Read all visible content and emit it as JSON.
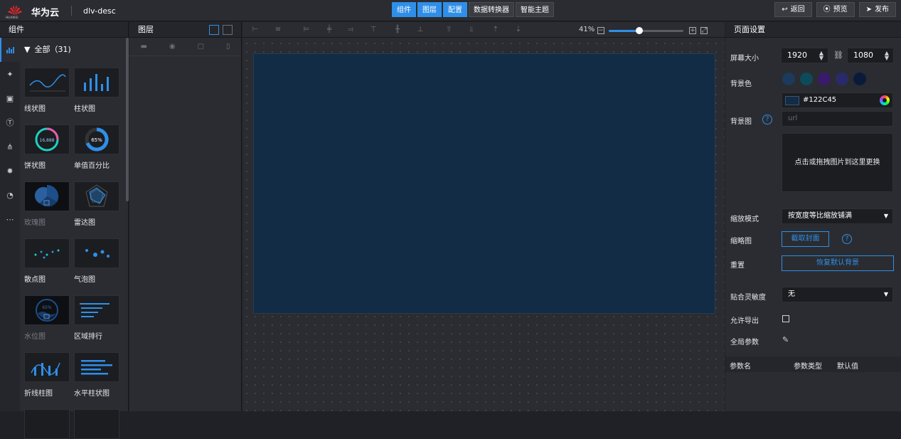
{
  "header": {
    "logo_text": "HUAWEI",
    "brand": "华为云",
    "project": "dlv-desc",
    "tabs": [
      {
        "label": "组件",
        "active": true
      },
      {
        "label": "图层",
        "active": true
      },
      {
        "label": "配置",
        "active": true
      },
      {
        "label": "数据转换器",
        "active": false
      },
      {
        "label": "智能主题",
        "active": false
      }
    ],
    "actions": {
      "back": "返回",
      "preview": "预览",
      "publish": "发布"
    }
  },
  "components": {
    "title": "组件",
    "category_label": "全部（31)",
    "items": [
      {
        "label": "线状图",
        "disabled": false
      },
      {
        "label": "柱状图",
        "disabled": false
      },
      {
        "label": "饼状图",
        "disabled": false
      },
      {
        "label": "单值百分比",
        "disabled": false
      },
      {
        "label": "玫瑰图",
        "disabled": true
      },
      {
        "label": "雷达图",
        "disabled": false
      },
      {
        "label": "散点图",
        "disabled": false
      },
      {
        "label": "气泡图",
        "disabled": false
      },
      {
        "label": "水位图",
        "disabled": true
      },
      {
        "label": "区域排行",
        "disabled": false
      },
      {
        "label": "折线柱图",
        "disabled": false
      },
      {
        "label": "水平柱状图",
        "disabled": false
      }
    ],
    "thumb_texts": {
      "pie": "16,888",
      "percent": "65%",
      "water": "65%"
    }
  },
  "layers": {
    "title": "图层"
  },
  "canvas": {
    "zoom": "41%",
    "zoom_fraction": 0.41
  },
  "settings": {
    "title": "页面设置",
    "screen_size_label": "屏幕大小",
    "width": "1920",
    "height": "1080",
    "bg_color_label": "背景色",
    "swatches": [
      "#1c3a5c",
      "#0d4a5a",
      "#3a1a6b",
      "#2a2a6a",
      "#0a1a3a"
    ],
    "bg_color_value": "#122C45",
    "bg_image_label": "背景图",
    "url_placeholder": "url",
    "drop_text": "点击或拖拽图片到这里更换",
    "scale_label": "缩放模式",
    "scale_value": "按宽度等比缩放铺满",
    "thumb_label": "缩略图",
    "capture_btn": "截取封面",
    "reset_label": "重置",
    "reset_btn": "恢复默认背景",
    "snap_label": "贴合灵敏度",
    "snap_value": "无",
    "export_label": "允许导出",
    "global_label": "全局参数",
    "param_cols": [
      "参数名",
      "参数类型",
      "默认值"
    ]
  },
  "colors": {
    "accent": "#2f8fe8",
    "stage": "#122c45"
  }
}
